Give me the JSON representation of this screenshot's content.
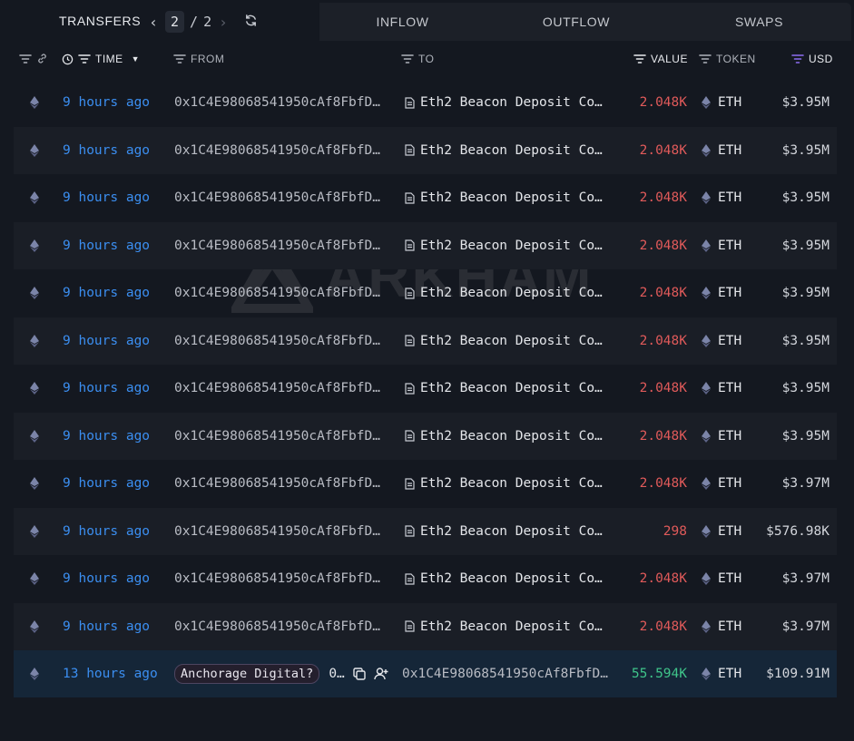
{
  "tabs": {
    "transfers": "TRANSFERS",
    "inflow": "INFLOW",
    "outflow": "OUTFLOW",
    "swaps": "SWAPS"
  },
  "pager": {
    "current": "2",
    "separator": "/",
    "total": "2"
  },
  "columns": {
    "time": "TIME",
    "from": "FROM",
    "to": "TO",
    "value": "VALUE",
    "token": "TOKEN",
    "usd": "USD"
  },
  "watermark": "ARKHAM",
  "rows": [
    {
      "time": "9 hours ago",
      "from": "0x1C4E98068541950cAf8FbfD…",
      "to": "Eth2 Beacon Deposit Co…",
      "value": "2.048K",
      "token": "ETH",
      "usd": "$3.95M"
    },
    {
      "time": "9 hours ago",
      "from": "0x1C4E98068541950cAf8FbfD…",
      "to": "Eth2 Beacon Deposit Co…",
      "value": "2.048K",
      "token": "ETH",
      "usd": "$3.95M"
    },
    {
      "time": "9 hours ago",
      "from": "0x1C4E98068541950cAf8FbfD…",
      "to": "Eth2 Beacon Deposit Co…",
      "value": "2.048K",
      "token": "ETH",
      "usd": "$3.95M"
    },
    {
      "time": "9 hours ago",
      "from": "0x1C4E98068541950cAf8FbfD…",
      "to": "Eth2 Beacon Deposit Co…",
      "value": "2.048K",
      "token": "ETH",
      "usd": "$3.95M"
    },
    {
      "time": "9 hours ago",
      "from": "0x1C4E98068541950cAf8FbfD…",
      "to": "Eth2 Beacon Deposit Co…",
      "value": "2.048K",
      "token": "ETH",
      "usd": "$3.95M"
    },
    {
      "time": "9 hours ago",
      "from": "0x1C4E98068541950cAf8FbfD…",
      "to": "Eth2 Beacon Deposit Co…",
      "value": "2.048K",
      "token": "ETH",
      "usd": "$3.95M"
    },
    {
      "time": "9 hours ago",
      "from": "0x1C4E98068541950cAf8FbfD…",
      "to": "Eth2 Beacon Deposit Co…",
      "value": "2.048K",
      "token": "ETH",
      "usd": "$3.95M"
    },
    {
      "time": "9 hours ago",
      "from": "0x1C4E98068541950cAf8FbfD…",
      "to": "Eth2 Beacon Deposit Co…",
      "value": "2.048K",
      "token": "ETH",
      "usd": "$3.95M"
    },
    {
      "time": "9 hours ago",
      "from": "0x1C4E98068541950cAf8FbfD…",
      "to": "Eth2 Beacon Deposit Co…",
      "value": "2.048K",
      "token": "ETH",
      "usd": "$3.97M"
    },
    {
      "time": "9 hours ago",
      "from": "0x1C4E98068541950cAf8FbfD…",
      "to": "Eth2 Beacon Deposit Co…",
      "value": "298",
      "token": "ETH",
      "usd": "$576.98K"
    },
    {
      "time": "9 hours ago",
      "from": "0x1C4E98068541950cAf8FbfD…",
      "to": "Eth2 Beacon Deposit Co…",
      "value": "2.048K",
      "token": "ETH",
      "usd": "$3.97M"
    },
    {
      "time": "9 hours ago",
      "from": "0x1C4E98068541950cAf8FbfD…",
      "to": "Eth2 Beacon Deposit Co…",
      "value": "2.048K",
      "token": "ETH",
      "usd": "$3.97M"
    }
  ],
  "last_row": {
    "time": "13 hours ago",
    "from_entity": "Anchorage Digital?",
    "from_addr": "0…",
    "to": "0x1C4E98068541950cAf8FbfD…",
    "value": "55.594K",
    "token": "ETH",
    "usd": "$109.91M"
  },
  "colors": {
    "time_link": "#3b8ef0",
    "value_out": "#e05a5a",
    "value_in": "#3fc48a",
    "usd_sort": "#8b6cf0"
  }
}
